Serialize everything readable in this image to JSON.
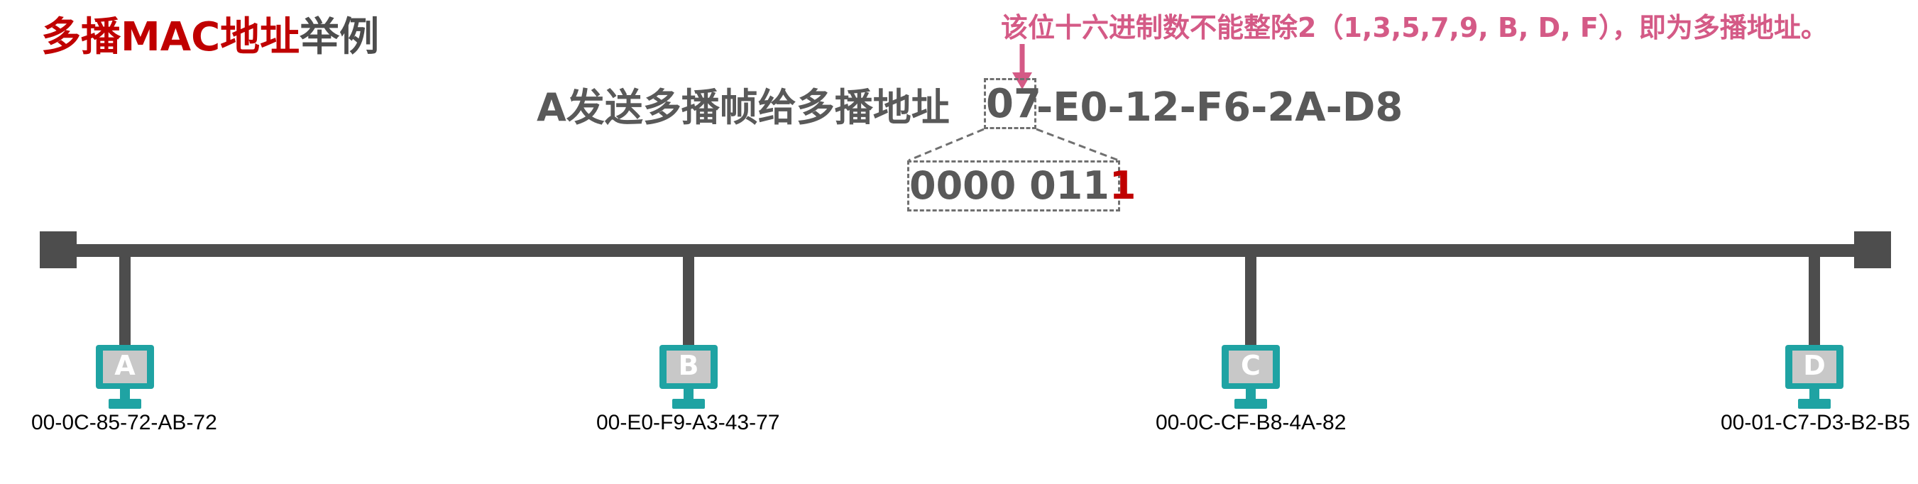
{
  "title": {
    "highlight": "多播MAC地址",
    "rest": "举例"
  },
  "note": "该位十六进制数不能整除2（1,3,5,7,9, B, D, F），即为多播地址。",
  "sentence": "A发送多播帧给多播地址",
  "mac": {
    "first_byte": "07",
    "rest": "-E0-12-F6-2A-D8"
  },
  "binary": {
    "prefix": "0000 011",
    "lsb": "1"
  },
  "hosts": [
    {
      "letter": "A",
      "mac": "00-0C-85-72-AB-72"
    },
    {
      "letter": "B",
      "mac": "00-E0-F9-A3-43-77"
    },
    {
      "letter": "C",
      "mac": "00-0C-CF-B8-4A-82"
    },
    {
      "letter": "D",
      "mac": "00-01-C7-D3-B2-B5"
    }
  ],
  "colors": {
    "title_red": "#c00000",
    "note_pink": "#d45a86",
    "bus_gray": "#4d4d4d",
    "monitor_teal": "#1fa3a3",
    "screen_gray": "#c8c8c8"
  },
  "icons": {
    "host": "computer-monitor-icon",
    "pointer": "down-arrow-icon"
  }
}
